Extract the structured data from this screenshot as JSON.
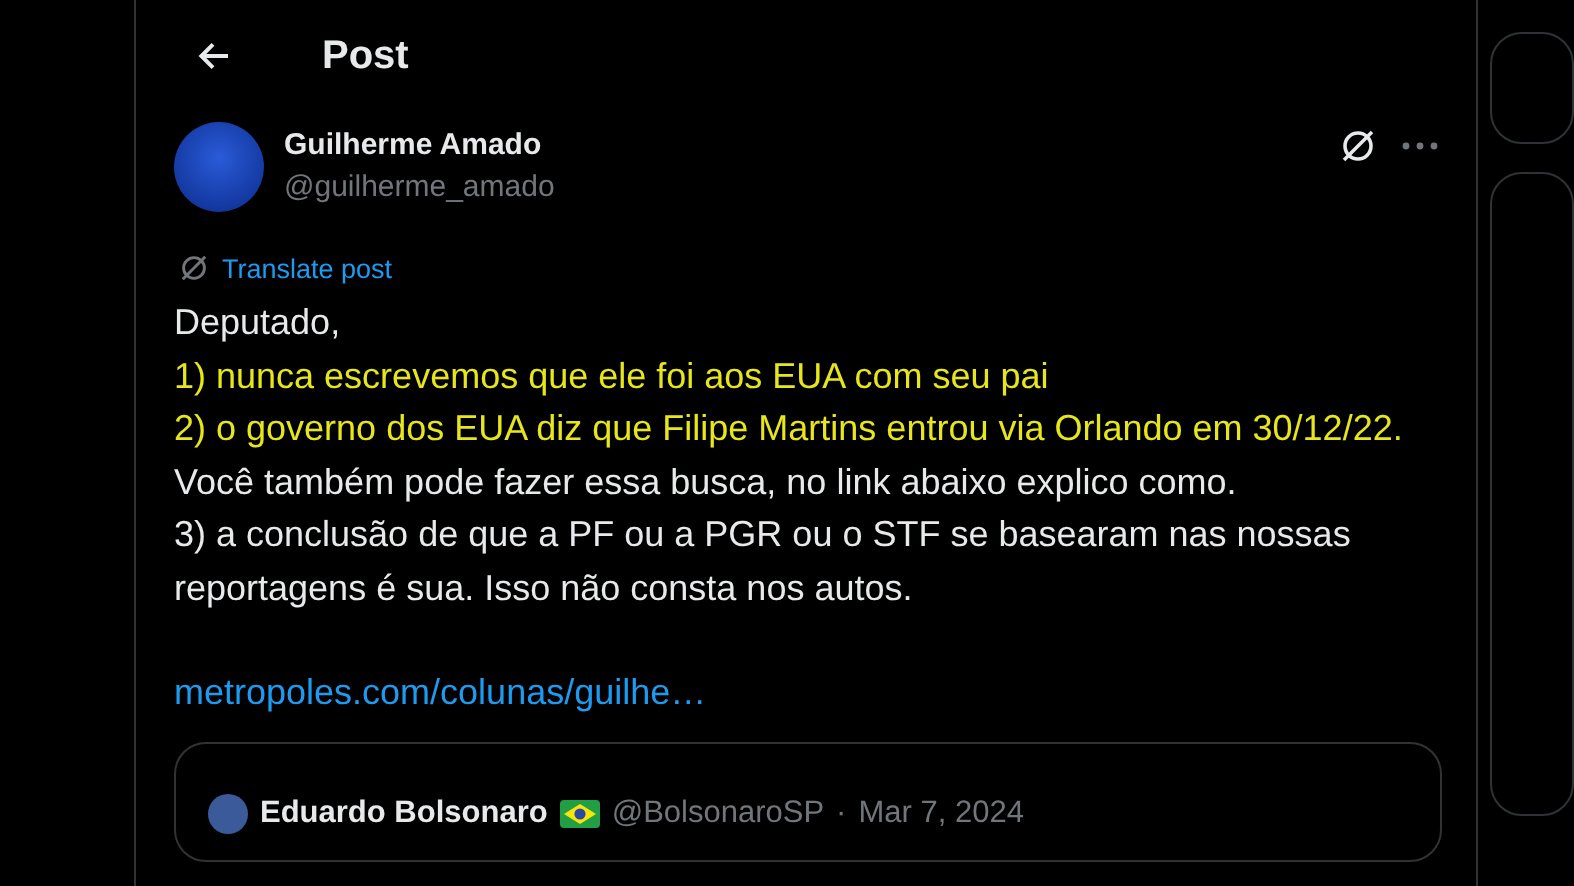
{
  "header": {
    "title": "Post"
  },
  "post": {
    "author": {
      "name": "Guilherme Amado",
      "handle": "@guilherme_amado"
    },
    "translate_label": "Translate post",
    "paragraphs": [
      {
        "segments": [
          {
            "text": "Deputado,",
            "highlighted": false
          }
        ]
      },
      {
        "segments": [
          {
            "text": "1) nunca escrevemos que ele foi aos EUA com seu pai",
            "highlighted": true
          }
        ]
      },
      {
        "segments": [
          {
            "text": "2) o governo dos EUA diz que Filipe Martins entrou via Orlando em 30/12/22.",
            "highlighted": true
          },
          {
            "text": " Você também pode fazer essa busca, no link abaixo explico como.",
            "highlighted": false
          }
        ]
      },
      {
        "segments": [
          {
            "text": "3) a conclusão de que a PF ou a PGR ou o STF se basearam nas nossas reportagens é sua. Isso não consta nos autos.",
            "highlighted": false
          }
        ]
      }
    ],
    "link": "metropoles.com/colunas/guilhe…",
    "quoted": {
      "name": "Eduardo Bolsonaro",
      "handle": "@BolsonaroSP",
      "separator": "·",
      "date": "Mar 7, 2024"
    }
  }
}
